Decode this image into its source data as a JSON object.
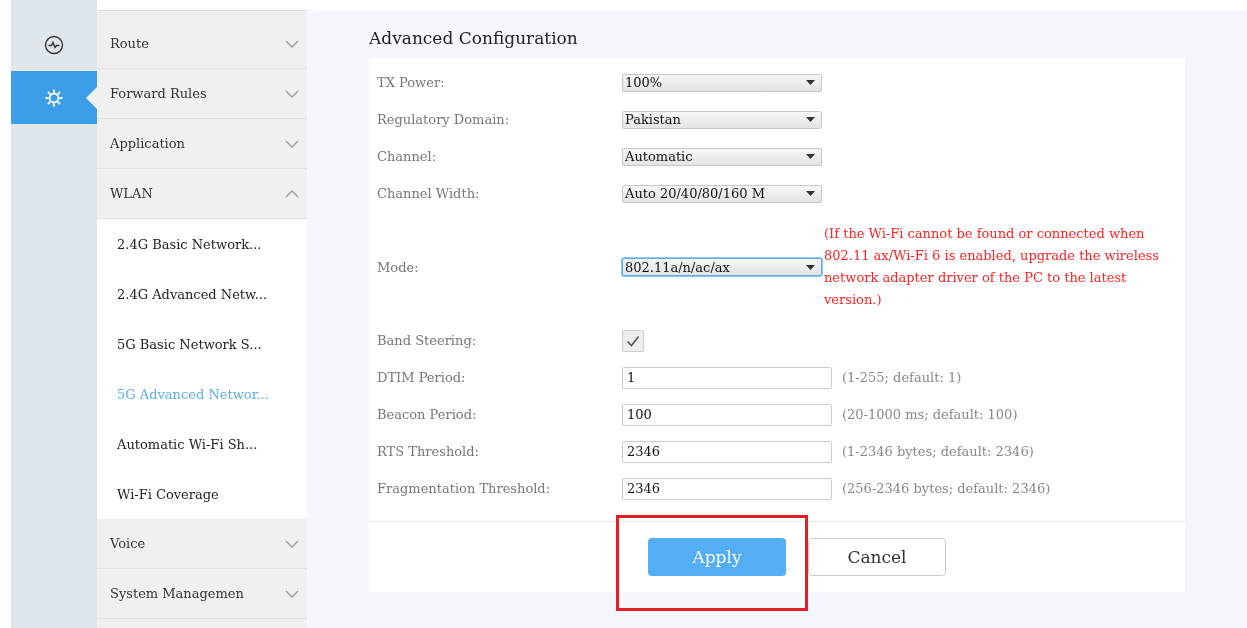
{
  "rail": [
    {
      "kind": "monitor",
      "selected": false
    },
    {
      "kind": "settings",
      "selected": true
    }
  ],
  "menu": [
    {
      "label": "Route",
      "expanded": false
    },
    {
      "label": "Forward Rules",
      "expanded": false
    },
    {
      "label": "Application",
      "expanded": false
    },
    {
      "label": "WLAN",
      "expanded": true,
      "children": [
        {
          "label": "2.4G Basic Network...",
          "selected": false
        },
        {
          "label": "2.4G Advanced Netw...",
          "selected": false
        },
        {
          "label": "5G Basic Network S...",
          "selected": false
        },
        {
          "label": "5G Advanced Networ...",
          "selected": true
        },
        {
          "label": "Automatic Wi-Fi Sh...",
          "selected": false
        },
        {
          "label": "Wi-Fi Coverage",
          "selected": false
        }
      ]
    },
    {
      "label": "Voice",
      "expanded": false
    },
    {
      "label": "System Managemen",
      "expanded": false
    }
  ],
  "section": {
    "title": "Advanced Configuration"
  },
  "fields": [
    {
      "label": "TX Power:",
      "kind": "select",
      "value": "100%",
      "focused": false
    },
    {
      "label": "Regulatory Domain:",
      "kind": "select",
      "value": "Pakistan",
      "focused": false
    },
    {
      "label": "Channel:",
      "kind": "select",
      "value": "Automatic",
      "focused": false
    },
    {
      "label": "Channel Width:",
      "kind": "select",
      "value": "Auto 20/40/80/160 M",
      "focused": false
    },
    {
      "label": "Mode:",
      "kind": "select",
      "value": "802.11a/n/ac/ax",
      "focused": true,
      "note": "(If the Wi-Fi cannot be found or connected when 802.11 ax/Wi-Fi 6 is enabled, upgrade the wireless network adapter driver of the PC to the latest version.)"
    },
    {
      "label": "Band Steering:",
      "kind": "checkbox",
      "checked": true
    },
    {
      "label": "DTIM Period:",
      "kind": "text",
      "value": "1",
      "hint": "(1-255; default: 1)"
    },
    {
      "label": "Beacon Period:",
      "kind": "text",
      "value": "100",
      "hint": "(20-1000 ms; default: 100)"
    },
    {
      "label": "RTS Threshold:",
      "kind": "text",
      "value": "2346",
      "hint": "(1-2346 bytes; default: 2346)"
    },
    {
      "label": "Fragmentation Threshold:",
      "kind": "text",
      "value": "2346",
      "hint": "(256-2346 bytes; default: 2346)"
    }
  ],
  "buttons": [
    {
      "label": "Apply",
      "kind": "primary",
      "highlighted": true
    },
    {
      "label": "Cancel",
      "kind": "secondary",
      "highlighted": false
    }
  ]
}
